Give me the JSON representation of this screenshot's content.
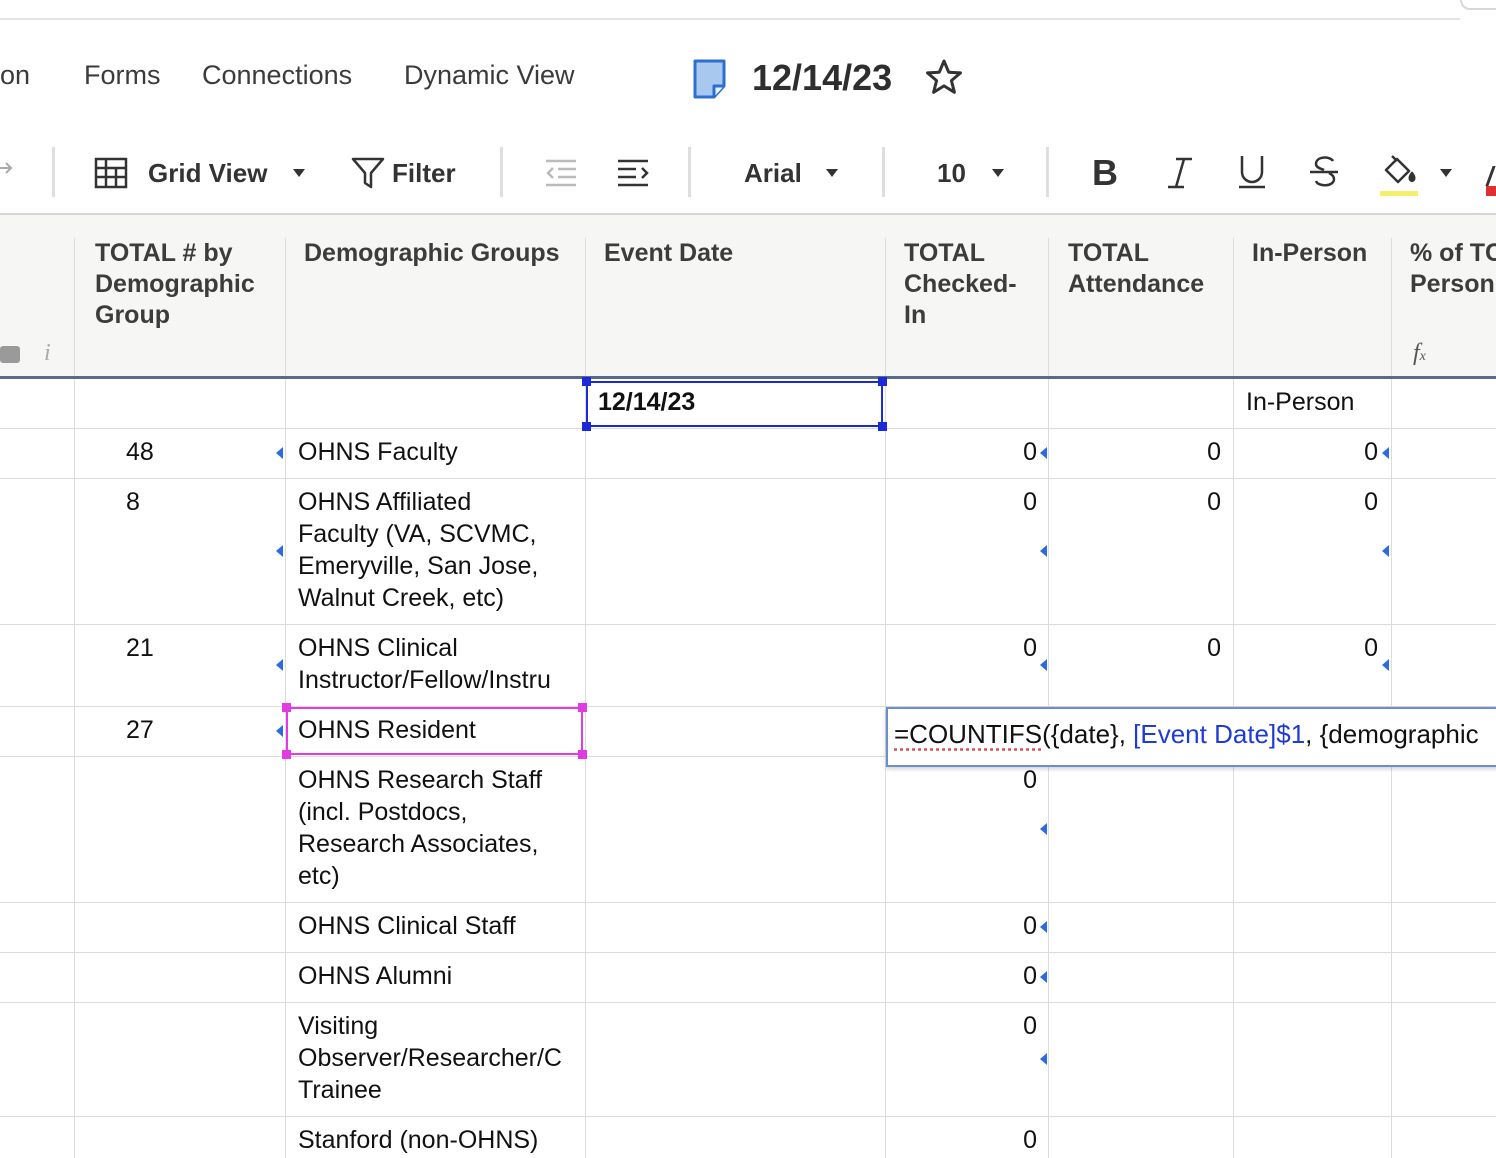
{
  "nav": {
    "partial_item": "on",
    "items": [
      "Forms",
      "Connections",
      "Dynamic View"
    ],
    "sheet_name": "12/14/23",
    "sheet_icon": "sheet-icon",
    "favorite_icon": "star-icon"
  },
  "toolbar": {
    "view_label": "Grid View",
    "filter_label": "Filter",
    "font_name": "Arial",
    "font_size": "10",
    "icons": [
      "grid-icon",
      "filter-icon",
      "outdent-icon",
      "indent-icon",
      "bold-icon",
      "italic-icon",
      "underline-icon",
      "strikethrough-icon",
      "fill-color-icon"
    ],
    "fill_color_swatch": "#f4f06a",
    "text_color_swatch": "#e03030"
  },
  "columns": [
    {
      "name": "TOTAL # by Demographic Group"
    },
    {
      "name": "Demographic Groups"
    },
    {
      "name": "Event Date"
    },
    {
      "name": "TOTAL Checked-In"
    },
    {
      "name": "TOTAL Attendance"
    },
    {
      "name": "In-Person"
    },
    {
      "name": "% of TOTAL In-Person"
    }
  ],
  "header_visible": {
    "c1": [
      "TOTAL # by",
      "Demographic",
      "Group"
    ],
    "c2": [
      "Demographic Groups"
    ],
    "c3": [
      "Event Date"
    ],
    "c4": [
      "TOTAL",
      "Checked-",
      "In"
    ],
    "c5": [
      "TOTAL",
      "Attendance"
    ],
    "c6": [
      "In-Person"
    ],
    "c7": [
      "% of TC",
      "Person"
    ]
  },
  "rows": [
    {
      "total_by_group": "",
      "group": "",
      "event_date": "12/14/23",
      "checked_in": "",
      "attendance": "",
      "in_person": "In-Person"
    },
    {
      "total_by_group": "48",
      "group": "OHNS Faculty",
      "checked_in": "0",
      "attendance": "0",
      "in_person": "0"
    },
    {
      "total_by_group": "8",
      "group_lines": [
        "OHNS Affiliated",
        "Faculty (VA, SCVMC,",
        "Emeryville, San Jose,",
        "Walnut Creek, etc)"
      ],
      "checked_in": "0",
      "attendance": "0",
      "in_person": "0"
    },
    {
      "total_by_group": "21",
      "group_lines": [
        "OHNS Clinical",
        "Instructor/Fellow/Instru"
      ],
      "checked_in": "0",
      "attendance": "0",
      "in_person": "0"
    },
    {
      "total_by_group": "27",
      "group": "OHNS Resident"
    },
    {
      "group_lines": [
        "OHNS Research Staff",
        "(incl. Postdocs,",
        "Research Associates,",
        "etc)"
      ],
      "checked_in": "0"
    },
    {
      "group": "OHNS Clinical Staff",
      "checked_in": "0"
    },
    {
      "group": "OHNS Alumni",
      "checked_in": "0"
    },
    {
      "group_lines": [
        "Visiting",
        "Observer/Researcher/C",
        "Trainee"
      ],
      "checked_in": "0"
    },
    {
      "group": "Stanford (non-OHNS)",
      "checked_in": "0"
    }
  ],
  "formula": {
    "part1": "=COUNTIFS",
    "part2": "({date}, ",
    "ref": "[Event Date]$1",
    "part3": ", {demographic"
  }
}
